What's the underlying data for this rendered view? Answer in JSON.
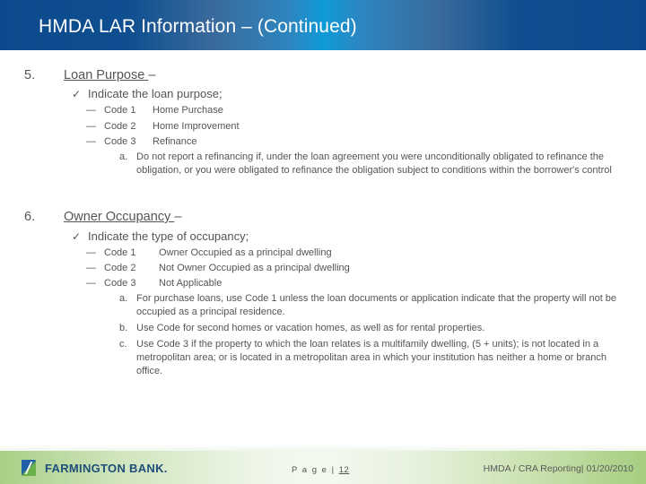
{
  "header": {
    "title": "HMDA LAR Information – (Continued)"
  },
  "sections": [
    {
      "number": "5.",
      "title": "Loan Purpose ",
      "title_suffix": "–",
      "check_icon": "checkmark-icon",
      "instruction": "Indicate the loan purpose;",
      "codes": [
        {
          "dash": "—",
          "code": "Code 1",
          "description": "Home Purchase"
        },
        {
          "dash": "—",
          "code": "Code 2",
          "description": "Home Improvement"
        },
        {
          "dash": "—",
          "code": "Code 3",
          "description": "Refinance"
        }
      ],
      "notes": [
        {
          "label": "a.",
          "text": "Do not report a refinancing if, under the loan agreement you were unconditionally obligated to refinance the obligation, or you were obligated to refinance the obligation subject to conditions within the borrower's control"
        }
      ]
    },
    {
      "number": "6.",
      "title": "Owner Occupancy ",
      "title_suffix": "–",
      "check_icon": "checkmark-icon",
      "instruction": "Indicate the type of occupancy;",
      "codes": [
        {
          "dash": "—",
          "code": "Code 1",
          "description": "Owner Occupied as a principal dwelling"
        },
        {
          "dash": "—",
          "code": "Code 2",
          "description": "Not Owner Occupied as a principal dwelling"
        },
        {
          "dash": "—",
          "code": "Code 3",
          "description": "Not Applicable"
        }
      ],
      "notes": [
        {
          "label": "a.",
          "text": "For purchase loans, use Code 1 unless the loan documents or application indicate that the property will not be occupied as a principal residence."
        },
        {
          "label": "b.",
          "text": "Use Code for second homes or vacation homes, as well as for rental properties."
        },
        {
          "label": "c.",
          "text": "Use Code 3 if the property to which the loan relates is a multifamily dwelling, (5 + units); is not located in a metropolitan area; or is located in a metropolitan area in which your institution has neither a home or branch office."
        }
      ]
    }
  ],
  "footer": {
    "logo_text": "FARMINGTON BANK.",
    "page_label": "P a g e | ",
    "page_number": "12",
    "right_text": "HMDA / CRA Reporting| 01/20/2010"
  },
  "colors": {
    "header_blue": "#0b4a8c",
    "header_highlight": "#0f9ad8",
    "footer_green": "#a9cf86",
    "body_text": "#555555",
    "logo_blue": "#1f4e7a"
  }
}
